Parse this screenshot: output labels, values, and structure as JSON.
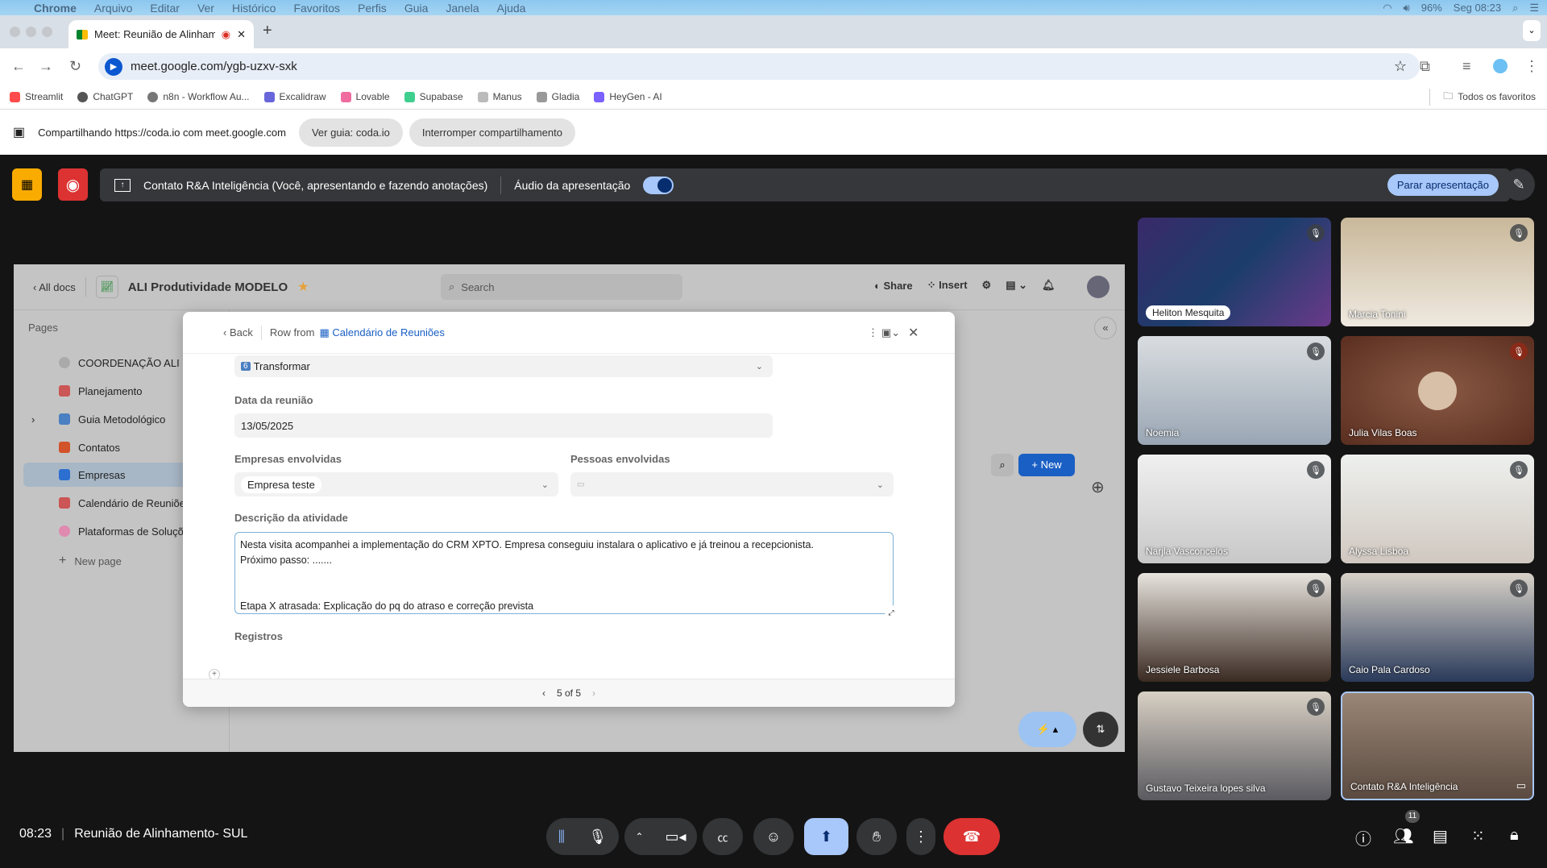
{
  "menubar": {
    "app": "Chrome",
    "items": [
      "Arquivo",
      "Editar",
      "Ver",
      "Histórico",
      "Favoritos",
      "Perfis",
      "Guia",
      "Janela",
      "Ajuda"
    ],
    "battery": "96%",
    "clock": "Seg 08:23"
  },
  "browser": {
    "tab_title": "Meet: Reunião de Alinham",
    "url": "meet.google.com/ygb-uzxv-sxk",
    "bookmarks": [
      "Streamlit",
      "ChatGPT",
      "n8n - Workflow Au...",
      "Excalidraw",
      "Lovable",
      "Supabase",
      "Manus",
      "Gladia",
      "HeyGen - AI"
    ],
    "all_bookmarks": "Todos os favoritos"
  },
  "sharebar": {
    "text": "Compartilhando https://coda.io com meet.google.com",
    "view_tab": "Ver guia: coda.io",
    "stop_sharing": "Interromper compartilhamento"
  },
  "presenting": {
    "text": "Contato R&A Inteligência (Você, apresentando e fazendo anotações)",
    "audio_label": "Áudio da apresentação",
    "audio_on": true,
    "stop": "Parar apresentação"
  },
  "coda": {
    "all_docs": "All docs",
    "doc_title": "ALI Produtividade MODELO",
    "search_placeholder": "Search",
    "share": "Share",
    "insert": "Insert",
    "pages_label": "Pages",
    "pages": [
      "COORDENAÇÃO ALI PD",
      "Planejamento",
      "Guia Metodológico",
      "Contatos",
      "Empresas",
      "Calendário de Reuniões",
      "Plataformas de Soluções"
    ],
    "new_page": "New page",
    "new_button": "New",
    "modal": {
      "back": "Back",
      "row_from": "Row from",
      "table": "Calendário de Reuniões",
      "stage": "Transformar",
      "stage_num": "6",
      "date_label": "Data da reunião",
      "date": "13/05/2025",
      "companies_label": "Empresas envolvidas",
      "company": "Empresa teste",
      "people_label": "Pessoas envolvidas",
      "desc_label": "Descrição da atividade",
      "desc_lines": [
        "Nesta visita acompanhei a implementação do CRM XPTO. Empresa conseguiu instalara o aplicativo e já treinou a recepcionista.",
        "Próximo passo: .......",
        "",
        "",
        "Etapa X atrasada: Explicação do pq do atraso e correção prevista"
      ],
      "records_label": "Registros",
      "pager": "5 of 5"
    }
  },
  "participants": [
    "Heliton Mesquita",
    "Marcia Tonini",
    "Noemia",
    "Julia Vilas Boas",
    "Narjla Vasconcelos",
    "Alyssa Lisboa",
    "Jessiele Barbosa",
    "Caio Pala Cardoso",
    "Gustavo Teixeira lopes silva",
    "Contato R&A Inteligência"
  ],
  "meeting": {
    "time": "08:23",
    "title": "Reunião de Alinhamento- SUL",
    "people_count": "11"
  },
  "colors": {
    "accent": "#a8c7fa",
    "end_call": "#dc3232",
    "coda_blue": "#1a5fc4"
  }
}
